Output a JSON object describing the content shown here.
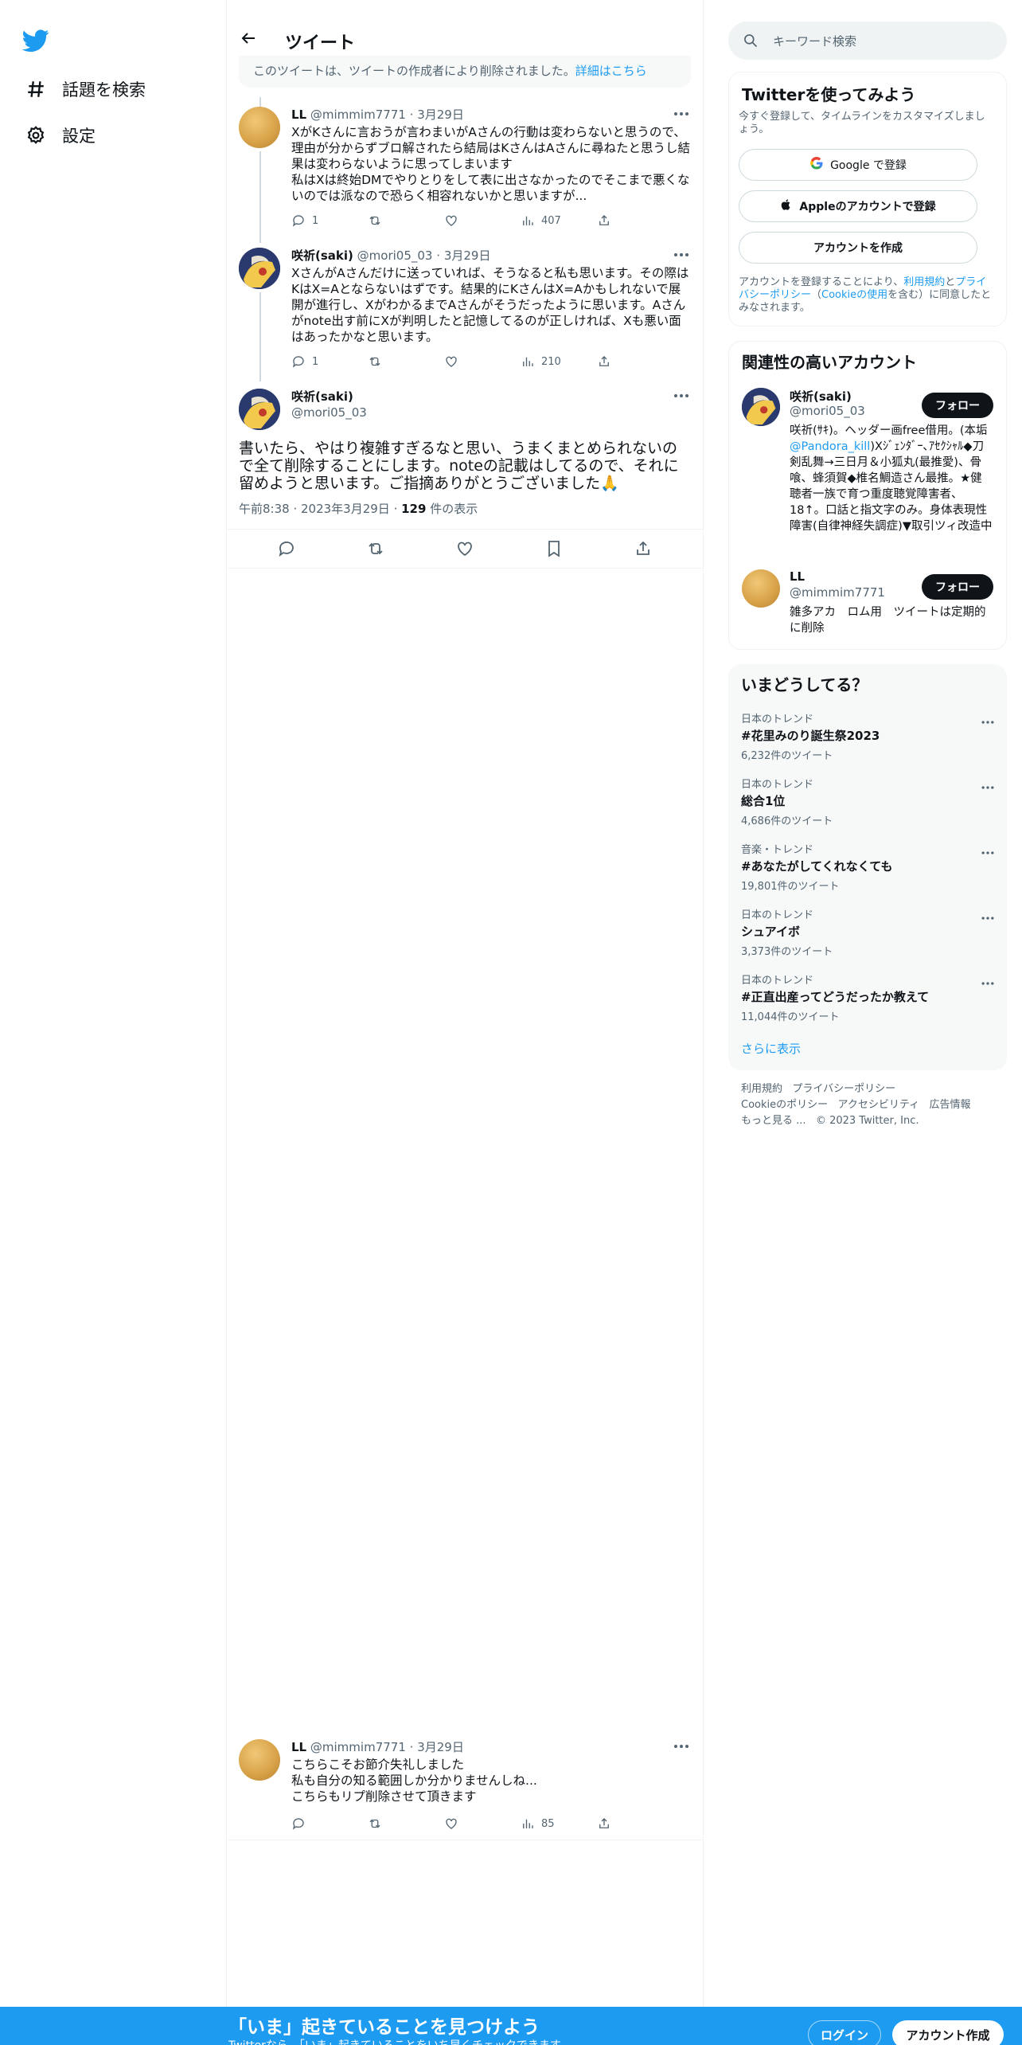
{
  "nav": {
    "explore_label": "話題を検索",
    "settings_label": "設定"
  },
  "header": {
    "title": "ツイート"
  },
  "deleted_notice": {
    "text": "このツイートは、ツイートの作成者により削除されました。",
    "link": "詳細はこちら"
  },
  "thread": [
    {
      "name": "LL",
      "handle": "@mimmim7771",
      "date": "3月29日",
      "text": "XがKさんに言おうが言わまいがAさんの行動は変わらないと思うので、理由が分からずブロ解されたら結局はKさんはAさんに尋ねたと思うし結果は変わらないように思ってしまいます\n私はXは終始DMでやりとりをして表に出さなかったのでそこまで悪くないのでは派なので恐らく相容れないかと思いますが...",
      "replies": "1",
      "views": "407"
    },
    {
      "name": "咲祈(saki)",
      "handle": "@mori05_03",
      "date": "3月29日",
      "text": "XさんがAさんだけに送っていれば、そうなると私も思います。その際はKはX=Aとならないはずです。結果的にKさんはX=Aかもしれないで展開が進行し、XがわかるまでAさんがそうだったように思います。Aさんがnote出す前にXが判明したと記憶してるのが正しければ、Xも悪い面はあったかなと思います。",
      "replies": "1",
      "views": "210"
    }
  ],
  "main_tweet": {
    "name": "咲祈(saki)",
    "handle": "@mori05_03",
    "text": "書いたら、やはり複雑すぎるなと思い、うまくまとめられないので全て削除することにします。noteの記載はしてるので、それに留めようと思います。ご指摘ありがとうございました🙏",
    "time": "午前8:38",
    "date": "2023年3月29日",
    "views_count": "129",
    "views_label": "件の表示"
  },
  "reply": {
    "name": "LL",
    "handle": "@mimmim7771",
    "date": "3月29日",
    "text": "こちらこそお節介失礼しました\n私も自分の知る範囲しか分かりませんしね...\nこちらもリプ削除させて頂きます",
    "views": "85"
  },
  "search": {
    "placeholder": "キーワード検索"
  },
  "signup_card": {
    "title": "Twitterを使ってみよう",
    "subtitle": "今すぐ登録して、タイムラインをカスタマイズしましょう。",
    "google": "Google で登録",
    "apple": "Appleのアカウントで登録",
    "create": "アカウントを作成",
    "legal_pre": "アカウントを登録することにより、",
    "legal_terms": "利用規約",
    "legal_and": "と",
    "legal_privacy": "プライバシーポリシー",
    "legal_paren_open": "（",
    "legal_cookie": "Cookieの使用",
    "legal_post": "を含む）に同意したとみなされます。"
  },
  "related": {
    "title": "関連性の高いアカウント",
    "follow_label": "フォロー",
    "accounts": [
      {
        "name": "咲祈(saki)",
        "handle": "@mori05_03",
        "bio_pre": "咲祈(ｻｷ)。ヘッダー画free借用。(本垢",
        "bio_link": "@Pandora_kill",
        "bio_post": ")Xｼﾞｪﾝﾀﾞｰ､ｱｾｸｼｬﾙ◆刀剣乱舞→三日月＆小狐丸(最推愛)、骨喰、蜂須賀◆椎名鯛造さん最推。★健聴者一族で育つ重度聴覚障害者、18↑。口話と指文字のみ。身体表現性障害(自律神経失調症)▼取引ツィ改造中"
      },
      {
        "name": "LL",
        "handle": "@mimmim7771",
        "bio_pre": "雑多アカ　ロム用　ツイートは定期的に削除",
        "bio_link": "",
        "bio_post": ""
      }
    ]
  },
  "trends": {
    "title": "いまどうしてる？",
    "items": [
      {
        "meta": "日本のトレンド",
        "name": "#花里みのり誕生祭2023",
        "count": "6,232件のツイート"
      },
      {
        "meta": "日本のトレンド",
        "name": "総合1位",
        "count": "4,686件のツイート"
      },
      {
        "meta": "音楽・トレンド",
        "name": "#あなたがしてくれなくても",
        "count": "19,801件のツイート"
      },
      {
        "meta": "日本のトレンド",
        "name": "シュアイボ",
        "count": "3,373件のツイート"
      },
      {
        "meta": "日本のトレンド",
        "name": "#正直出産ってどうだったか教えて",
        "count": "11,044件のツイート"
      }
    ],
    "show_more": "さらに表示"
  },
  "footer": {
    "terms": "利用規約",
    "privacy": "プライバシーポリシー",
    "cookie": "Cookieのポリシー",
    "accessibility": "アクセシビリティ",
    "ads": "広告情報",
    "more": "もっと見る ...",
    "copyright": "© 2023 Twitter, Inc."
  },
  "bottom_bar": {
    "title": "「いま」起きていることを見つけよう",
    "subtitle": "Twitterなら、「いま」起きていることをいち早くチェックできます。",
    "login": "ログイン",
    "signup": "アカウント作成"
  },
  "colors": {
    "accent": "#1d9bf0",
    "text": "#0f1419",
    "muted": "#536471"
  }
}
